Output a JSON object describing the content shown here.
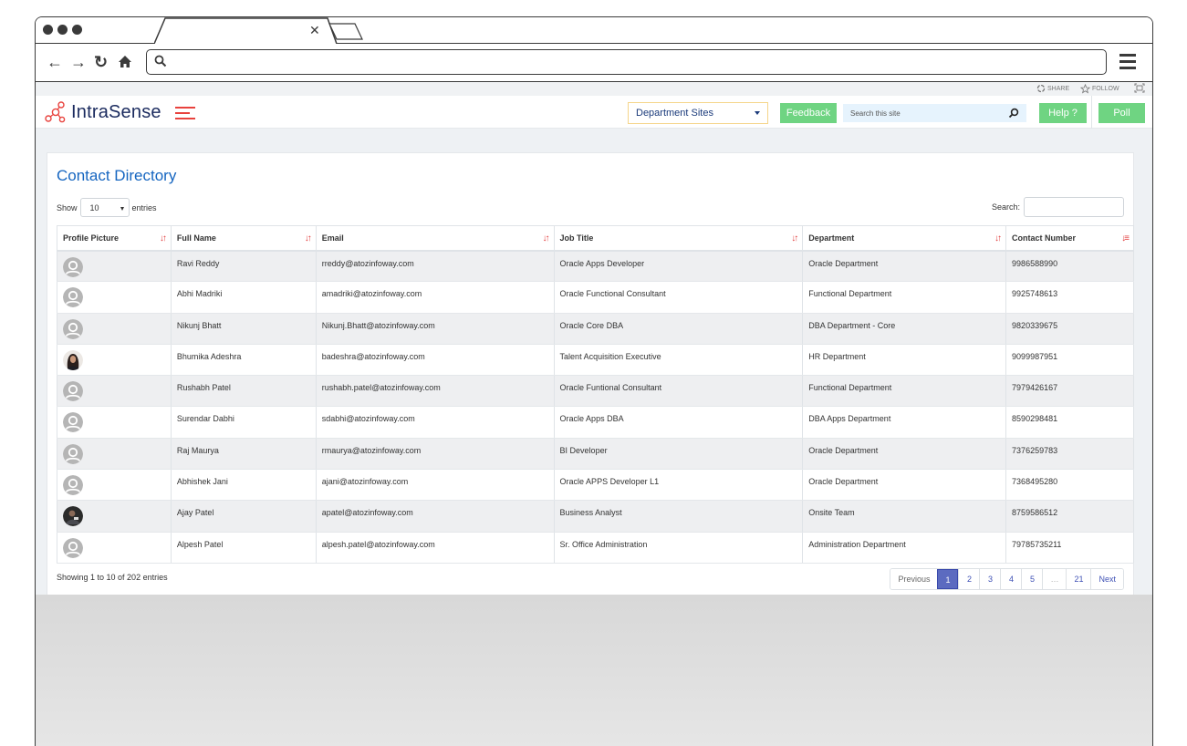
{
  "browser": {
    "tab_close_icon": "close-icon",
    "nav_icons": [
      "back-arrow-icon",
      "forward-arrow-icon",
      "reload-icon",
      "home-icon"
    ],
    "url": "",
    "menu_icon": "hamburger-icon"
  },
  "utility_bar": {
    "share_label": "SHARE",
    "follow_label": "FOLLOW"
  },
  "header": {
    "logo_text": "IntraSense",
    "department_select": "Department Sites",
    "feedback_label": "Feedback",
    "search_placeholder": "Search this site",
    "help_label": "Help ?",
    "poll_label": "Poll",
    "colors": {
      "accent_green": "#6fd482",
      "brand_red": "#e8423d",
      "brand_navy": "#1a2a5e"
    }
  },
  "directory": {
    "title": "Contact Directory",
    "show_label": "Show",
    "page_length": "10",
    "entries_label": "entries",
    "search_label": "Search:",
    "search_value": "",
    "columns": [
      "Profile Picture",
      "Full Name",
      "Email",
      "Job Title",
      "Department",
      "Contact Number"
    ],
    "rows": [
      {
        "avatar": "default",
        "name": "Ravi Reddy",
        "email": "rreddy@atozinfoway.com",
        "job": "Oracle Apps Developer",
        "dept": "Oracle Department",
        "phone": "9986588990"
      },
      {
        "avatar": "default",
        "name": "Abhi Madriki",
        "email": "amadriki@atozinfoway.com",
        "job": "Oracle Functional Consultant",
        "dept": "Functional Department",
        "phone": "9925748613"
      },
      {
        "avatar": "default",
        "name": "Nikunj Bhatt",
        "email": "Nikunj.Bhatt@atozinfoway.com",
        "job": "Oracle Core DBA",
        "dept": "DBA Department - Core",
        "phone": "9820339675"
      },
      {
        "avatar": "photo-female",
        "name": "Bhumika Adeshra",
        "email": "badeshra@atozinfoway.com",
        "job": "Talent Acquisition Executive",
        "dept": "HR Department",
        "phone": "9099987951"
      },
      {
        "avatar": "default",
        "name": "Rushabh Patel",
        "email": "rushabh.patel@atozinfoway.com",
        "job": "Oracle Funtional Consultant",
        "dept": "Functional Department",
        "phone": "7979426167"
      },
      {
        "avatar": "default",
        "name": "Surendar Dabhi",
        "email": "sdabhi@atozinfoway.com",
        "job": "Oracle Apps DBA",
        "dept": "DBA Apps Department",
        "phone": "8590298481"
      },
      {
        "avatar": "default",
        "name": "Raj Maurya",
        "email": "rmaurya@atozinfoway.com",
        "job": "BI Developer",
        "dept": "Oracle Department",
        "phone": "7376259783"
      },
      {
        "avatar": "default",
        "name": "Abhishek Jani",
        "email": "ajani@atozinfoway.com",
        "job": "Oracle APPS Developer L1",
        "dept": "Oracle Department",
        "phone": "7368495280"
      },
      {
        "avatar": "photo-male",
        "name": "Ajay Patel",
        "email": "apatel@atozinfoway.com",
        "job": "Business Analyst",
        "dept": "Onsite Team",
        "phone": "8759586512"
      },
      {
        "avatar": "default",
        "name": "Alpesh Patel",
        "email": "alpesh.patel@atozinfoway.com",
        "job": "Sr. Office Administration",
        "dept": "Administration Department",
        "phone": "79785735211"
      }
    ],
    "info": "Showing 1 to 10 of 202 entries",
    "pagination": {
      "previous": "Previous",
      "pages": [
        "1",
        "2",
        "3",
        "4",
        "5",
        "…",
        "21"
      ],
      "active": "1",
      "next": "Next"
    }
  }
}
